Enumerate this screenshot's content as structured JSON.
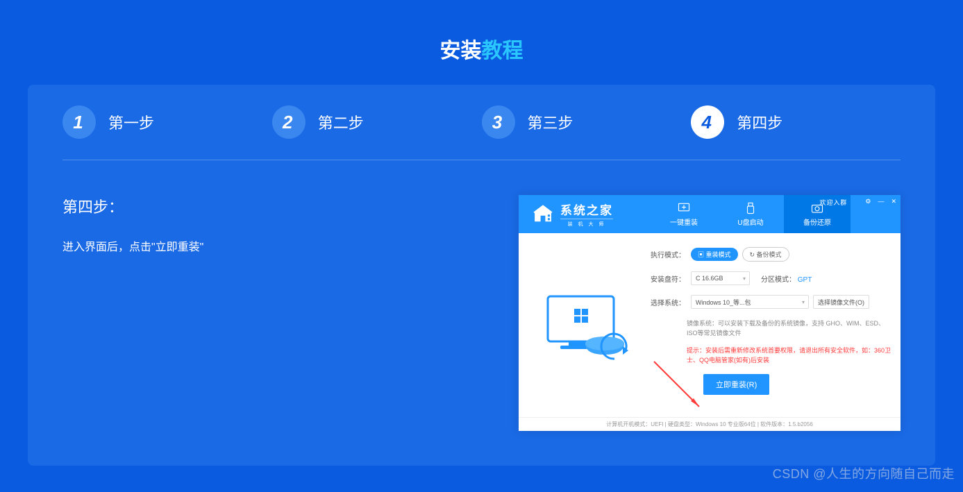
{
  "title": {
    "part1": "安装",
    "part2": "教程"
  },
  "steps": [
    {
      "num": "1",
      "label": "第一步"
    },
    {
      "num": "2",
      "label": "第二步"
    },
    {
      "num": "3",
      "label": "第三步"
    },
    {
      "num": "4",
      "label": "第四步"
    }
  ],
  "active_step": 3,
  "content": {
    "heading": "第四步：",
    "desc": "进入界面后，点击\"立即重装\""
  },
  "app": {
    "logo_main": "系统之家",
    "logo_sub": "装 机 大 师",
    "tabs": [
      {
        "label": "一键重装",
        "icon": "windows"
      },
      {
        "label": "U盘启动",
        "icon": "usb"
      },
      {
        "label": "备份还原",
        "icon": "camera"
      }
    ],
    "active_tab": 2,
    "win_top_text": "欢迎入群",
    "mode_label": "执行模式：",
    "mode_solid": "▣ 重装模式",
    "mode_outline": "↻ 备份模式",
    "disk_label": "安装盘符：",
    "disk_value": "C 16.6GB",
    "partition_key": "分区模式：",
    "partition_val": "GPT",
    "sys_label": "选择系统：",
    "sys_value": "Windows 10_等...包",
    "browse": "选择镜像文件(O)",
    "hint1_label": "镜像系统：",
    "hint1_text": "可以安装下载及备份的系统镜像，支持 GHO、WIM、ESD、ISO等常见镜像文件",
    "hint2_label": "提示：",
    "hint2_text": "安装后需重新修改系统首要权限，请退出所有安全软件，如：360卫士、QQ电脑管家(如有)后安装",
    "reinstall": "立即重装(R)",
    "status_bar": "计算机开机模式：UEFI | 硬盘类型：Windows 10 专业版64位 | 软件版本：1.5.b2056"
  },
  "watermark": "CSDN @人生的方向随自己而走"
}
